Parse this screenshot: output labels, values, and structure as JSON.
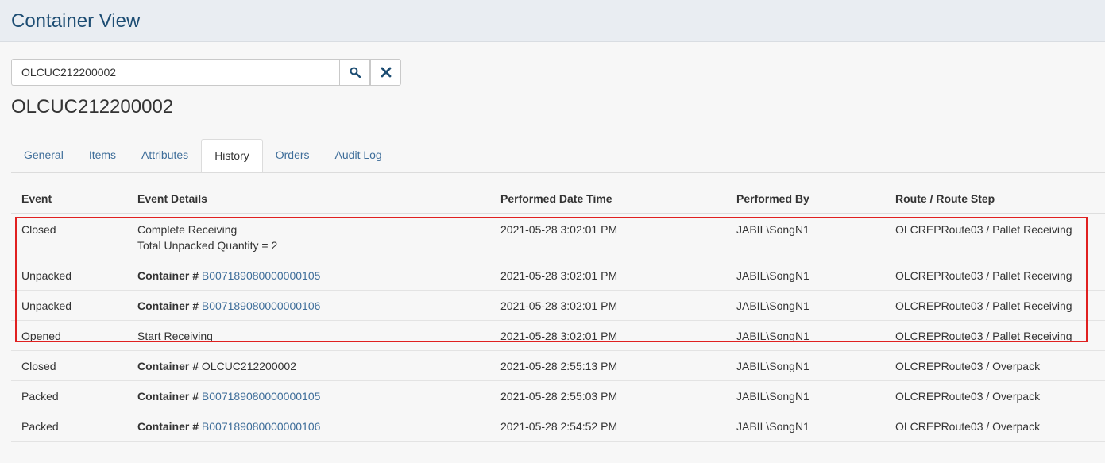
{
  "page": {
    "title": "Container View"
  },
  "search": {
    "value": "OLCUC212200002",
    "search_icon": "search-icon",
    "clear_icon": "close-icon"
  },
  "container": {
    "title": "OLCUC212200002"
  },
  "tabs": [
    {
      "label": "General",
      "active": false
    },
    {
      "label": "Items",
      "active": false
    },
    {
      "label": "Attributes",
      "active": false
    },
    {
      "label": "History",
      "active": true
    },
    {
      "label": "Orders",
      "active": false
    },
    {
      "label": "Audit Log",
      "active": false
    }
  ],
  "table": {
    "headers": [
      "Event",
      "Event Details",
      "Performed Date Time",
      "Performed By",
      "Route / Route Step"
    ],
    "rows": [
      {
        "event": "Closed",
        "details_line1": "Complete Receiving",
        "details_line2": "Total Unpacked Quantity = 2",
        "date": "2021-05-28 3:02:01 PM",
        "by": "JABIL\\SongN1",
        "route": "OLCREPRoute03 / Pallet Receiving"
      },
      {
        "event": "Unpacked",
        "details_label": "Container #",
        "details_value": "B007189080000000105",
        "date": "2021-05-28 3:02:01 PM",
        "by": "JABIL\\SongN1",
        "route": "OLCREPRoute03 / Pallet Receiving"
      },
      {
        "event": "Unpacked",
        "details_label": "Container #",
        "details_value": "B007189080000000106",
        "date": "2021-05-28 3:02:01 PM",
        "by": "JABIL\\SongN1",
        "route": "OLCREPRoute03 / Pallet Receiving"
      },
      {
        "event": "Opened",
        "details_line1": "Start Receiving",
        "date": "2021-05-28 3:02:01 PM",
        "by": "JABIL\\SongN1",
        "route": "OLCREPRoute03 / Pallet Receiving"
      },
      {
        "event": "Closed",
        "details_label": "Container #",
        "details_value": "OLCUC212200002",
        "date": "2021-05-28 2:55:13 PM",
        "by": "JABIL\\SongN1",
        "route": "OLCREPRoute03 / Overpack"
      },
      {
        "event": "Packed",
        "details_label": "Container #",
        "details_value": "B007189080000000105",
        "date": "2021-05-28 2:55:03 PM",
        "by": "JABIL\\SongN1",
        "route": "OLCREPRoute03 / Overpack"
      },
      {
        "event": "Packed",
        "details_label": "Container #",
        "details_value": "B007189080000000106",
        "date": "2021-05-28 2:54:52 PM",
        "by": "JABIL\\SongN1",
        "route": "OLCREPRoute03 / Overpack"
      }
    ]
  },
  "colors": {
    "header_bg": "#e9edf2",
    "title_color": "#1d4d73",
    "link_color": "#3f6e9a",
    "highlight_border": "#e02020"
  }
}
